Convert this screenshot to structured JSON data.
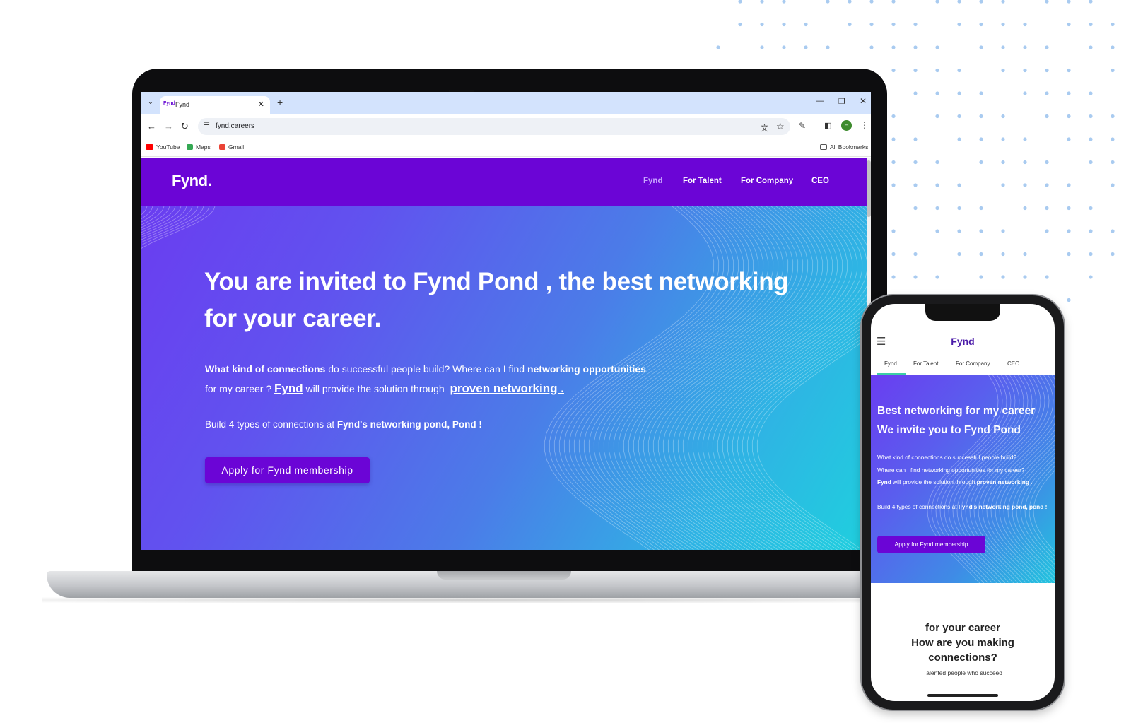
{
  "browser": {
    "tab_title": "Fynd",
    "tab_favicon": "Fynd",
    "new_tab": "+",
    "url": "fynd.careers",
    "bookmarks": [
      {
        "label": "YouTube",
        "icon": "youtube-icon",
        "color": "#ff0000"
      },
      {
        "label": "Maps",
        "icon": "maps-icon",
        "color": "#34a853"
      },
      {
        "label": "Gmail",
        "icon": "gmail-icon",
        "color": "#ea4335"
      }
    ],
    "all_bookmarks": "All Bookmarks",
    "profile_initial": "H"
  },
  "site": {
    "logo": "Fynd.",
    "nav": [
      "Fynd",
      "For Talent",
      "For Company",
      "CEO"
    ],
    "hero_title_line1": "You are invited to Fynd Pond , the best networking",
    "hero_title_line2": "for your career.",
    "hero_text": {
      "b1": "What kind of connections",
      "t1": " do successful people build? Where can I find ",
      "b2": "networking opportunities",
      "t2": "for my career ? ",
      "link1": "Fynd",
      "t3": " will provide the solution through ",
      "link2": "proven networking ."
    },
    "hero_sub_plain": "Build 4 types of connections at ",
    "hero_sub_bold": "Fynd's networking pond, Pond !",
    "cta": "Apply for Fynd membership",
    "colors": {
      "nav": "#6b05d6",
      "active_link": "#c9a7ff",
      "gradient_start": "#6a3df0",
      "gradient_end": "#1fd0de"
    }
  },
  "mobile": {
    "brand": "Fynd",
    "tabs": [
      "Fynd",
      "For Talent",
      "For Company",
      "CEO"
    ],
    "hero_title_line1": "Best networking for my career",
    "hero_title_line2": "We invite you to Fynd Pond",
    "text_line1": "What kind of connections do successful people build?",
    "text_line2": "Where can I find networking opportunities for my career?",
    "text_b1": "Fynd",
    "text_line3": " will provide the solution through ",
    "text_b2": "proven networking",
    "text_end": " .",
    "sub_plain": "Build 4 types of connections at ",
    "sub_bold": "Fynd's networking pond, pond !",
    "cta": "Apply for Fynd membership",
    "section_title_line1": "for your career",
    "section_title_line2": "How are you making",
    "section_title_line3": "connections?",
    "section_sub": "Talented people who succeed"
  }
}
